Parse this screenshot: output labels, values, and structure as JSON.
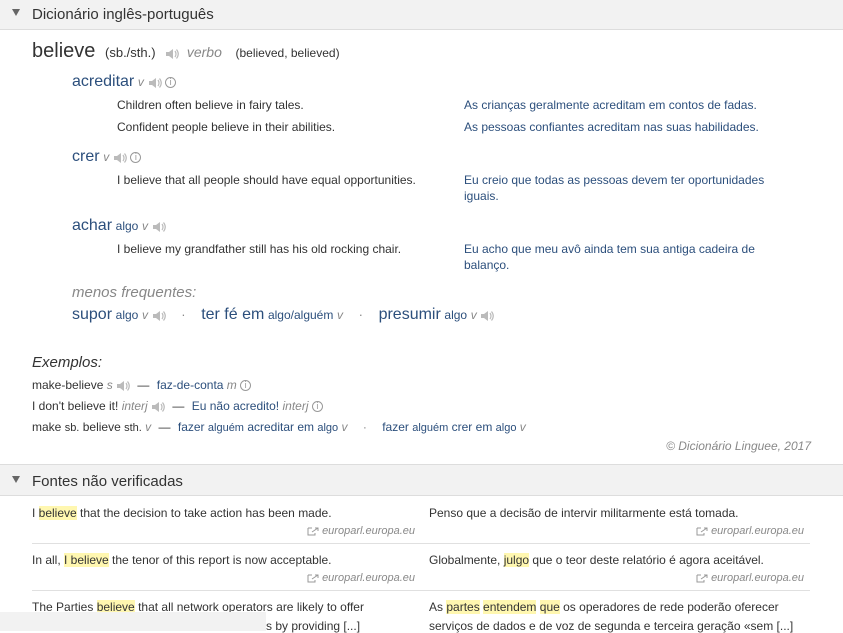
{
  "dict_section": {
    "title": "Dicionário inglês-português"
  },
  "lemma": {
    "word": "believe",
    "grammar": "(sb./sth.)",
    "pos": "verbo",
    "forms": "(believed, believed)"
  },
  "entries": [
    {
      "word": "acreditar",
      "pos": "v",
      "examples": [
        {
          "en": "Children often believe in fairy tales.",
          "pt": "As crianças geralmente acreditam em contos de fadas."
        },
        {
          "en": "Confident people believe in their abilities.",
          "pt": "As pessoas confiantes acreditam nas suas habilidades."
        }
      ]
    },
    {
      "word": "crer",
      "pos": "v",
      "examples": [
        {
          "en": "I believe that all people should have equal opportunities.",
          "pt1": "Eu creio que todas as pessoas devem ter oportunidades",
          "pt2": "iguais."
        }
      ]
    },
    {
      "word": "achar",
      "obj": "algo",
      "pos": "v",
      "examples": [
        {
          "en": "I believe my grandfather still has his old rocking chair.",
          "pt1": "Eu acho que meu avô ainda tem sua antiga cadeira de",
          "pt2": "balanço."
        }
      ]
    }
  ],
  "less_frequent": {
    "label": "menos frequentes:",
    "items": [
      {
        "word": "supor",
        "obj": "algo",
        "pos": "v"
      },
      {
        "word": "ter fé em",
        "obj": "algo/alguém",
        "pos": "v"
      },
      {
        "word": "presumir",
        "obj": "algo",
        "pos": "v"
      }
    ]
  },
  "examples_block": {
    "label": "Exemplos:",
    "rows": [
      {
        "en": "make-believe",
        "en_pos": "s",
        "sep": "—",
        "pt": "faz-de-conta",
        "pt_pos": "m"
      },
      {
        "en": "I don't believe it!",
        "en_pos": "interj",
        "sep": "—",
        "pt": "Eu não acredito!",
        "pt_pos": "interj"
      },
      {
        "en_a": "make",
        "en_b": "sb.",
        "en_c": "believe",
        "en_d": "sth.",
        "en_pos": "v",
        "sep": "—",
        "pt1_a": "fazer",
        "pt1_b": "alguém",
        "pt1_c": "acreditar em",
        "pt1_d": "algo",
        "pt1_pos": "v",
        "pt2_a": "fazer",
        "pt2_b": "alguém",
        "pt2_c": "crer em",
        "pt2_d": "algo",
        "pt2_pos": "v"
      }
    ],
    "copyright": "© Dicionário Linguee, 2017"
  },
  "sources_section": {
    "title": "Fontes não verificadas"
  },
  "sources": [
    {
      "en_pre": "I ",
      "en_hl": "believe",
      "en_post": " that the decision to take action has been made.",
      "pt": "Penso que a decisão de intervir militarmente está tomada.",
      "src_en": "europarl.europa.eu",
      "src_pt": "europarl.europa.eu"
    },
    {
      "en_pre": "In all, ",
      "en_hl": "I believe",
      "en_post": " the tenor of this report is now acceptable.",
      "pt_pre": "Globalmente, ",
      "pt_hl": "julgo",
      "pt_post": " que o teor deste relatório é agora aceitável.",
      "src_en": "europarl.europa.eu",
      "src_pt": "europarl.europa.eu"
    },
    {
      "en_pre": "The Parties ",
      "en_hl": "believe",
      "en_post": " that all network operators are likely to offer",
      "en2": "s by providing [...]",
      "pt_pre": "As ",
      "pt_hl1": "partes",
      "pt_mid": " ",
      "pt_hl2": "entendem",
      "pt_mid2": " ",
      "pt_hl3": "que",
      "pt_post": " os operadores de rede poderão oferecer",
      "pt2": "serviços de dados e de voz de segunda e terceira geração «sem [...]"
    }
  ]
}
